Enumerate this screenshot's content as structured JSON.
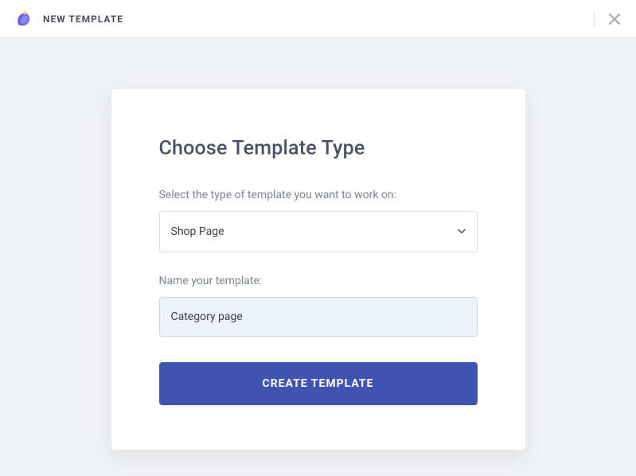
{
  "header": {
    "title": "NEW TEMPLATE"
  },
  "dialog": {
    "title": "Choose Template Type",
    "type_label": "Select the type of template you want to work on:",
    "type_selected": "Shop Page",
    "name_label": "Name your template:",
    "name_value": "Category page",
    "submit_label": "CREATE TEMPLATE"
  }
}
